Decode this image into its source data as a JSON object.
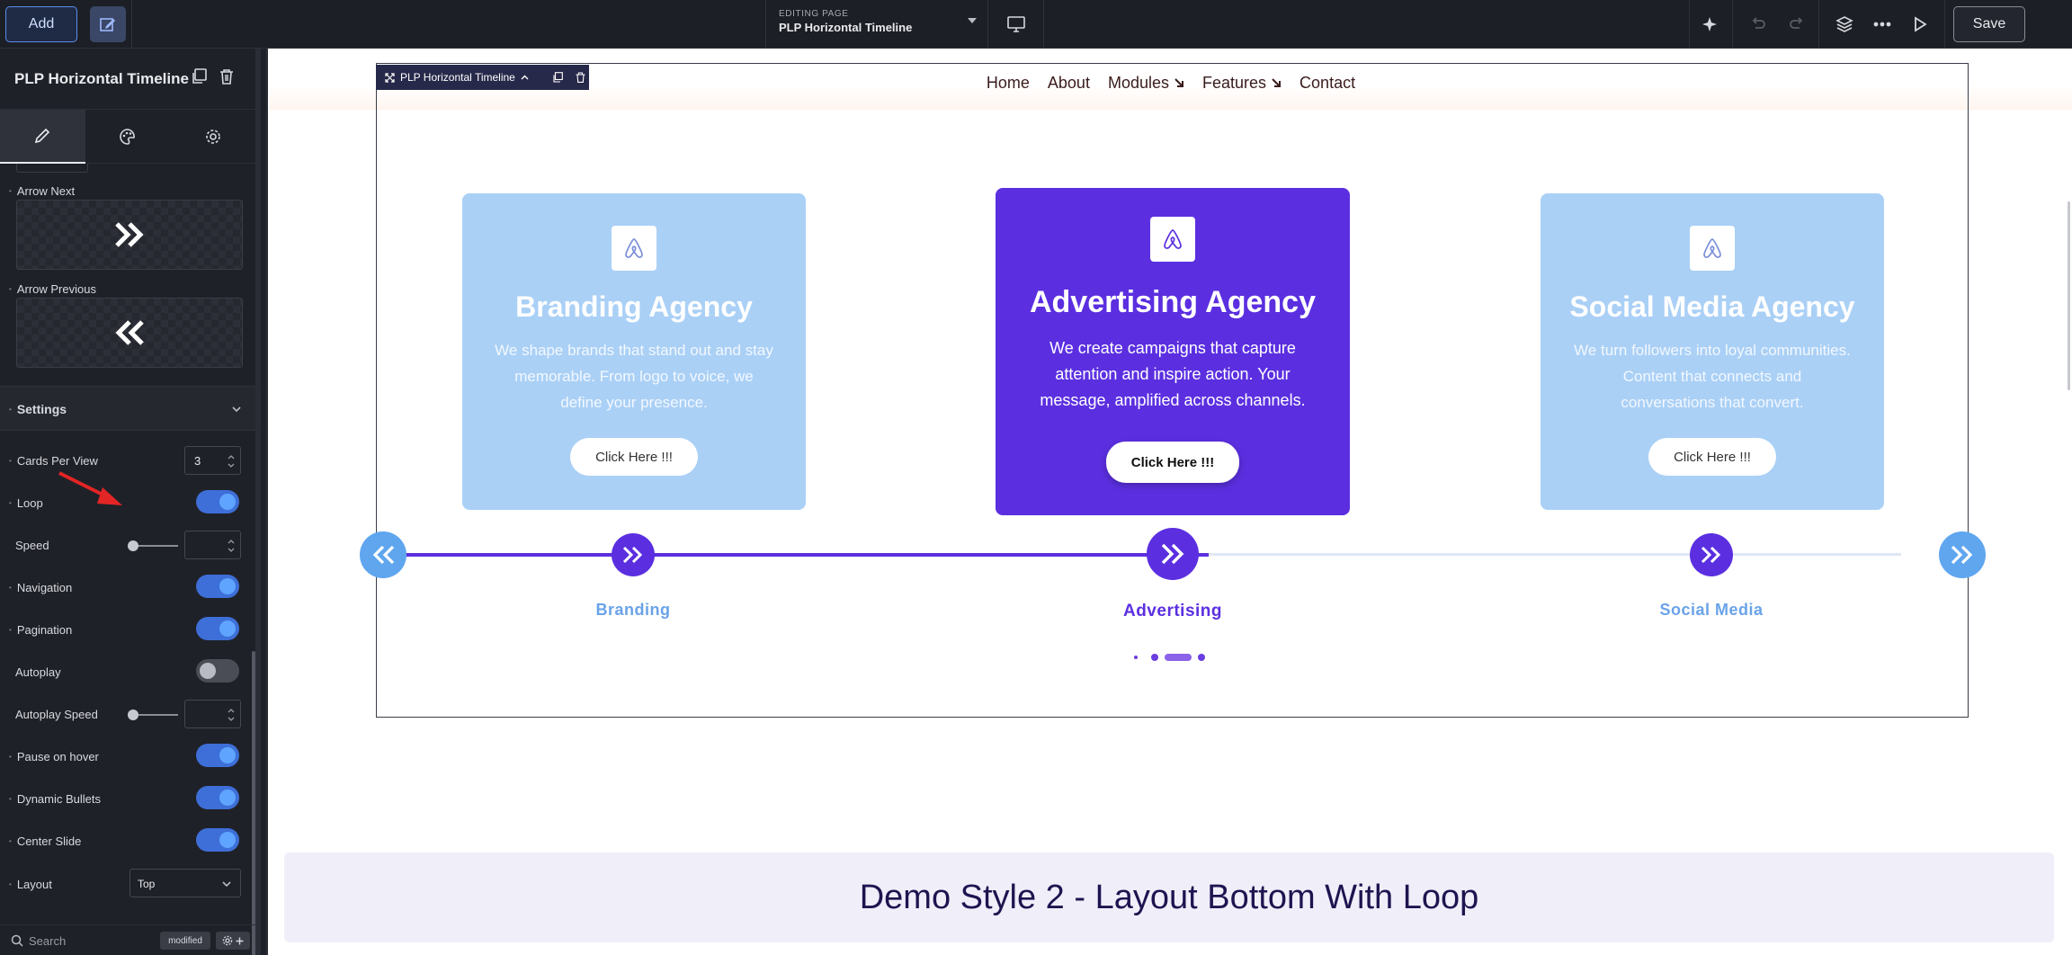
{
  "topbar": {
    "add_label": "Add",
    "editing_eyebrow": "EDITING PAGE",
    "page_name": "PLP Horizontal Timeline",
    "save_label": "Save"
  },
  "sidebar": {
    "title": "PLP Horizontal Timeline",
    "arrow_next_label": "Arrow Next",
    "arrow_prev_label": "Arrow Previous",
    "section_settings": "Settings",
    "fields": {
      "cards_per_view": {
        "label": "Cards Per View",
        "value": "3"
      },
      "loop": {
        "label": "Loop",
        "on": true
      },
      "speed": {
        "label": "Speed",
        "value": ""
      },
      "navigation": {
        "label": "Navigation",
        "on": true
      },
      "pagination": {
        "label": "Pagination",
        "on": true
      },
      "autoplay": {
        "label": "Autoplay",
        "on": false
      },
      "autoplay_speed": {
        "label": "Autoplay Speed",
        "value": ""
      },
      "pause_on_hover": {
        "label": "Pause on hover",
        "on": true
      },
      "dynamic_bullets": {
        "label": "Dynamic Bullets",
        "on": true
      },
      "center_slide": {
        "label": "Center Slide",
        "on": true
      },
      "layout": {
        "label": "Layout",
        "value": "Top"
      }
    },
    "footer": {
      "search_placeholder": "Search",
      "badge": "modified"
    }
  },
  "canvas": {
    "element_bar_label": "PLP Horizontal Timeline",
    "nav": [
      "Home",
      "About",
      "Modules",
      "Features",
      "Contact"
    ],
    "cards": [
      {
        "title": "Branding Agency",
        "text": [
          "We shape brands that stand out and stay",
          "memorable. From logo to voice, we",
          "define your presence."
        ],
        "cta": "Click Here !!!",
        "label": "Branding"
      },
      {
        "title": "Advertising Agency",
        "text": [
          "We create campaigns that capture",
          "attention and inspire action. Your",
          "message, amplified across channels."
        ],
        "cta": "Click Here !!!",
        "label": "Advertising"
      },
      {
        "title": "Social Media Agency",
        "text": [
          "We turn followers into loyal communities.",
          "Content that connects and",
          "conversations that convert."
        ],
        "cta": "Click Here !!!",
        "label": "Social Media"
      }
    ],
    "demo_heading": "Demo Style 2 - Layout Bottom With Loop"
  },
  "colors": {
    "accent": "#5b2fe0",
    "card_light": "#aad0f6",
    "node_light": "#5fa6ef",
    "toggle_on": "#3e6fd8"
  }
}
